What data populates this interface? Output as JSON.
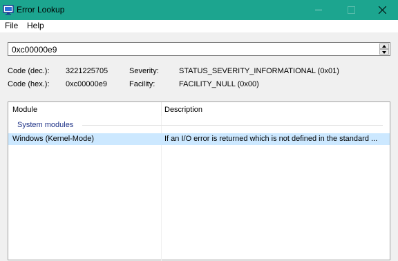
{
  "window": {
    "title": "Error Lookup",
    "icon": "monitor-icon",
    "accent_color": "#1ca58f"
  },
  "menu": {
    "items": [
      "File",
      "Help"
    ]
  },
  "input": {
    "value": "0xc00000e9"
  },
  "info": {
    "code_dec_label": "Code (dec.):",
    "code_dec_value": "3221225705",
    "code_hex_label": "Code (hex.):",
    "code_hex_value": "0xc00000e9",
    "severity_label": "Severity:",
    "severity_value": "STATUS_SEVERITY_INFORMATIONAL (0x01)",
    "facility_label": "Facility:",
    "facility_value": "FACILITY_NULL (0x00)"
  },
  "list": {
    "columns": [
      "Module",
      "Description"
    ],
    "group": "System modules",
    "rows": [
      {
        "module": "Windows (Kernel-Mode)",
        "description": "If an I/O error is returned which is not defined in the standard ..."
      }
    ],
    "selected_row_color": "#cce8ff"
  }
}
